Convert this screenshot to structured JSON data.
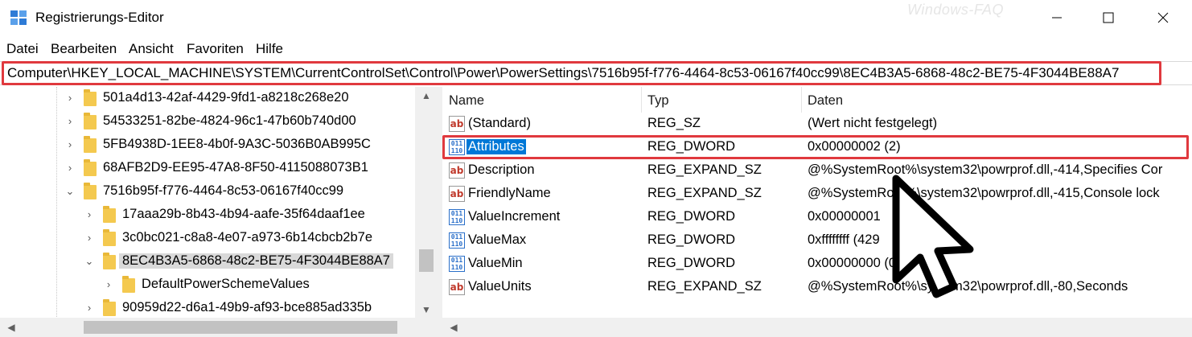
{
  "window": {
    "title": "Registrierungs-Editor",
    "watermark": "Windows-FAQ"
  },
  "menu": [
    {
      "label": "Datei"
    },
    {
      "label": "Bearbeiten"
    },
    {
      "label": "Ansicht"
    },
    {
      "label": "Favoriten"
    },
    {
      "label": "Hilfe"
    }
  ],
  "address": {
    "path": "Computer\\HKEY_LOCAL_MACHINE\\SYSTEM\\CurrentControlSet\\Control\\Power\\PowerSettings\\7516b95f-f776-4464-8c53-06167f40cc99\\8EC4B3A5-6868-48c2-BE75-4F3044BE88A7"
  },
  "tree": {
    "items": [
      {
        "label": "501a4d13-42af-4429-9fd1-a8218c268e20",
        "expanded": false
      },
      {
        "label": "54533251-82be-4824-96c1-47b60b740d00",
        "expanded": false
      },
      {
        "label": "5FB4938D-1EE8-4b0f-9A3C-5036B0AB995C",
        "expanded": false
      },
      {
        "label": "68AFB2D9-EE95-47A8-8F50-4115088073B1",
        "expanded": false
      },
      {
        "label": "7516b95f-f776-4464-8c53-06167f40cc99",
        "expanded": true
      },
      {
        "label": "17aaa29b-8b43-4b94-aafe-35f64daaf1ee",
        "expanded": false
      },
      {
        "label": "3c0bc021-c8a8-4e07-a973-6b14cbcb2b7e",
        "expanded": false
      },
      {
        "label": "8EC4B3A5-6868-48c2-BE75-4F3044BE88A7",
        "expanded": true,
        "selected": true
      },
      {
        "label": "DefaultPowerSchemeValues",
        "expanded": false
      },
      {
        "label": "90959d22-d6a1-49b9-af93-bce885ad335b",
        "expanded": false
      }
    ]
  },
  "list": {
    "columns": [
      "Name",
      "Typ",
      "Daten"
    ],
    "rows": [
      {
        "name": "(Standard)",
        "type": "REG_SZ",
        "data": "(Wert nicht festgelegt)",
        "icon": "string-value-icon"
      },
      {
        "name": "Attributes",
        "type": "REG_DWORD",
        "data": "0x00000002 (2)",
        "icon": "binary-value-icon",
        "selected": true
      },
      {
        "name": "Description",
        "type": "REG_EXPAND_SZ",
        "data": "@%SystemRoot%\\system32\\powrprof.dll,-414,Specifies Cor",
        "icon": "string-value-icon"
      },
      {
        "name": "FriendlyName",
        "type": "REG_EXPAND_SZ",
        "data": "@%SystemRoot%\\system32\\powrprof.dll,-415,Console lock",
        "icon": "string-value-icon"
      },
      {
        "name": "ValueIncrement",
        "type": "REG_DWORD",
        "data": "0x00000001",
        "icon": "binary-value-icon"
      },
      {
        "name": "ValueMax",
        "type": "REG_DWORD",
        "data": "0xffffffff (429",
        "icon": "binary-value-icon"
      },
      {
        "name": "ValueMin",
        "type": "REG_DWORD",
        "data": "0x00000000 (0)",
        "icon": "binary-value-icon"
      },
      {
        "name": "ValueUnits",
        "type": "REG_EXPAND_SZ",
        "data": "@%SystemRoot%\\system32\\powrprof.dll,-80,Seconds",
        "icon": "string-value-icon"
      }
    ]
  },
  "colors": {
    "highlight": "#e0393e",
    "selection": "#0078d7",
    "folder": "#f4c94f"
  }
}
